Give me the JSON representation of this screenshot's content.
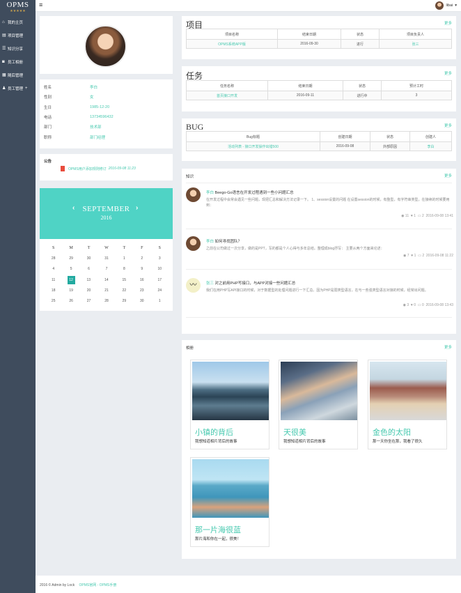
{
  "brand": {
    "name": "OPMS",
    "stars": "★★★★★"
  },
  "nav": [
    {
      "icon": "home-icon",
      "glyph": "⌂",
      "label": "我的主页"
    },
    {
      "icon": "book-icon",
      "glyph": "▤",
      "label": "项目管理"
    },
    {
      "icon": "share-icon",
      "glyph": "☰",
      "label": "知识分享"
    },
    {
      "icon": "camera-icon",
      "glyph": "◙",
      "label": "员工相册"
    },
    {
      "icon": "calendar-icon",
      "glyph": "▦",
      "label": "随后管理"
    },
    {
      "icon": "user-icon",
      "glyph": "♟",
      "label": "员工管理",
      "extra": "+"
    }
  ],
  "topbar": {
    "menu_glyph": "≡",
    "username": "libai",
    "caret": "▾"
  },
  "profile": {
    "rows": [
      {
        "label": "姓名",
        "value": "李白"
      },
      {
        "label": "性别",
        "value": "女"
      },
      {
        "label": "生日",
        "value": "1985-12-20"
      },
      {
        "label": "电话",
        "value": "13734596432"
      },
      {
        "label": "部门",
        "value": "技术部"
      },
      {
        "label": "职称",
        "value": "部门经理"
      }
    ]
  },
  "notice": {
    "title": "公告",
    "item": "OPMS用户添加规则修订",
    "date": "2016-09-08 11:23"
  },
  "calendar": {
    "month": "SEPTEMBER",
    "year": "2016",
    "weekdays": [
      "S",
      "M",
      "T",
      "W",
      "T",
      "F",
      "S"
    ],
    "weeks": [
      [
        "28",
        "29",
        "30",
        "31",
        "1",
        "2",
        "3"
      ],
      [
        "4",
        "5",
        "6",
        "7",
        "8",
        "9",
        "10"
      ],
      [
        "11",
        "12",
        "13",
        "14",
        "15",
        "16",
        "17"
      ],
      [
        "18",
        "19",
        "20",
        "21",
        "22",
        "23",
        "24"
      ],
      [
        "25",
        "26",
        "27",
        "28",
        "29",
        "30",
        "1"
      ]
    ],
    "today": "12"
  },
  "projects": {
    "title": "项目",
    "more": "更多",
    "columns": [
      "项目名称",
      "结束日期",
      "状态",
      "项目负责人"
    ],
    "rows": [
      [
        "OPMS系统APP版",
        "2016-09-30",
        "进行",
        "张三"
      ]
    ]
  },
  "tasks": {
    "title": "任务",
    "more": "更多",
    "columns": [
      "任务名称",
      "结束日期",
      "状态",
      "预计工时"
    ],
    "rows": [
      [
        "首页接口开发",
        "2016-09-11",
        "进行中",
        "3"
      ]
    ]
  },
  "bugs": {
    "title": "BUG",
    "more": "更多",
    "columns": [
      "Bug标题",
      "创建日期",
      "状态",
      "创建人"
    ],
    "rows": [
      [
        "活动列表 - 接口开发操作出错500",
        "2016-09-08",
        "外部原因",
        "李白"
      ]
    ]
  },
  "knowledge": {
    "title": "知识",
    "more": "更多",
    "items": [
      {
        "author": "李白",
        "title": "Beego-Go语言在开发过程遇到一些小问题汇总",
        "body": "在开发过程中会常会遇见一些问题，现把汇总和解决方法记录一下。 1、session设置的问题 在设置session的时候，有整型，有字符串类型，在接续的时候要用到：",
        "views": "11",
        "likes": "1",
        "comments": "2",
        "date": "2016-09-08 13:41"
      },
      {
        "author": "李白",
        "title": "如何寻找团队？",
        "body": "之前在公司做过一次分享，做的是PPT，写的都是个人心得与多年总结。整理成blog抒写： 主要从两个方面来论述：",
        "views": "7",
        "likes": "1",
        "comments": "2",
        "date": "2016-09-08 11:22"
      },
      {
        "author": "张三",
        "title": "对之前用PHP写接口，与APP对接一些问题汇总",
        "body": "我们在用PHP写API接口的时候，对于数据型的处理问题进行一下汇总。因为PHP是弱类型语言，在与一些强类型语言对接的时候，经常出问题。",
        "views": "3",
        "likes": "0",
        "comments": "0",
        "date": "2016-09-08 13:43"
      }
    ]
  },
  "album": {
    "title": "相册",
    "more": "更多",
    "cards": [
      {
        "title": "小镇的背后",
        "desc": "我想知道相片背后的故事"
      },
      {
        "title": "天很美",
        "desc": "我想知道相片背后的故事"
      },
      {
        "title": "金色的太阳",
        "desc": "那一天你坐在那，我看了很久"
      },
      {
        "title": "那一片海很蓝",
        "desc": "那片海和你在一起，很美！"
      }
    ]
  },
  "footer": {
    "copyright": "2016 © Admin by Lock",
    "link": "OPMS官网 - OPMS手册"
  },
  "colors": {
    "accent": "#47c9af",
    "sidebar": "#3f4c5d",
    "calendar_header": "#4fd3c5",
    "today": "#22aaa0"
  }
}
